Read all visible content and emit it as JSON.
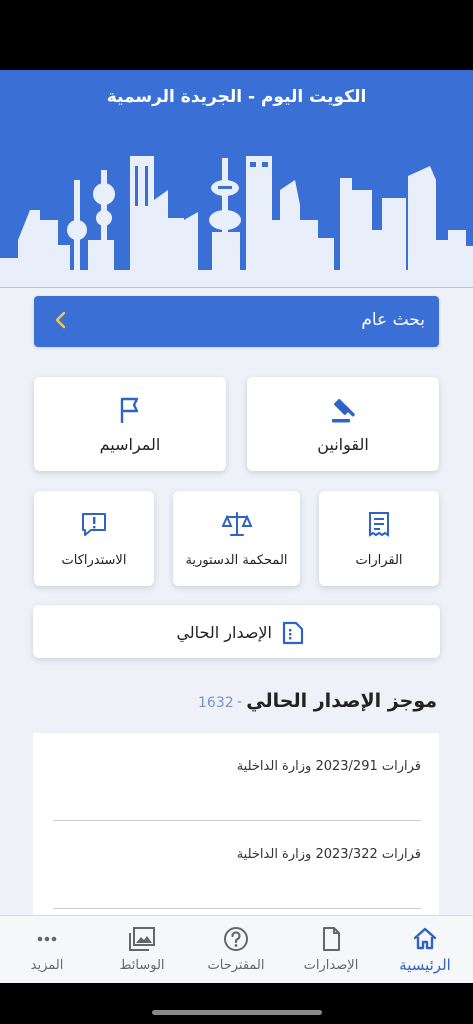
{
  "header": {
    "title": "الكويت اليوم - الجريدة الرسمية"
  },
  "search": {
    "label": "بحث عام"
  },
  "categories": {
    "laws": "القوانين",
    "decrees": "المراسيم",
    "decisions": "القرارات",
    "constitutional_court": "المحكمة الدستورية",
    "inquiries": "الاستدراكات"
  },
  "current_issue": {
    "label": "الإصدار الحالي"
  },
  "summary": {
    "title": "موجز الإصدار الحالي",
    "separator": "-",
    "issue_number": "1632",
    "items": [
      "قرارات 2023/291 وزارة الداخلية",
      "قرارات 2023/322 وزارة الداخلية"
    ]
  },
  "tabbar": {
    "home": "الرئيسية",
    "issues": "الإصدارات",
    "suggestions": "المقترحات",
    "media": "الوسائط",
    "more": "المزيد"
  },
  "colors": {
    "primary": "#3a6fd6",
    "active_tab": "#2f63c6",
    "background": "#eef1f7",
    "issue_number": "#7a92c4"
  },
  "icons": {
    "search_chevron": "chevron-left-icon",
    "laws": "gavel-icon",
    "decrees": "flag-icon",
    "decisions": "receipt-icon",
    "constitutional_court": "scales-icon",
    "inquiries": "comment-alert-icon",
    "current_issue": "document-icon",
    "home": "home-icon",
    "issues": "file-icon",
    "suggestions": "question-icon",
    "media": "images-icon",
    "more": "dots-icon"
  }
}
